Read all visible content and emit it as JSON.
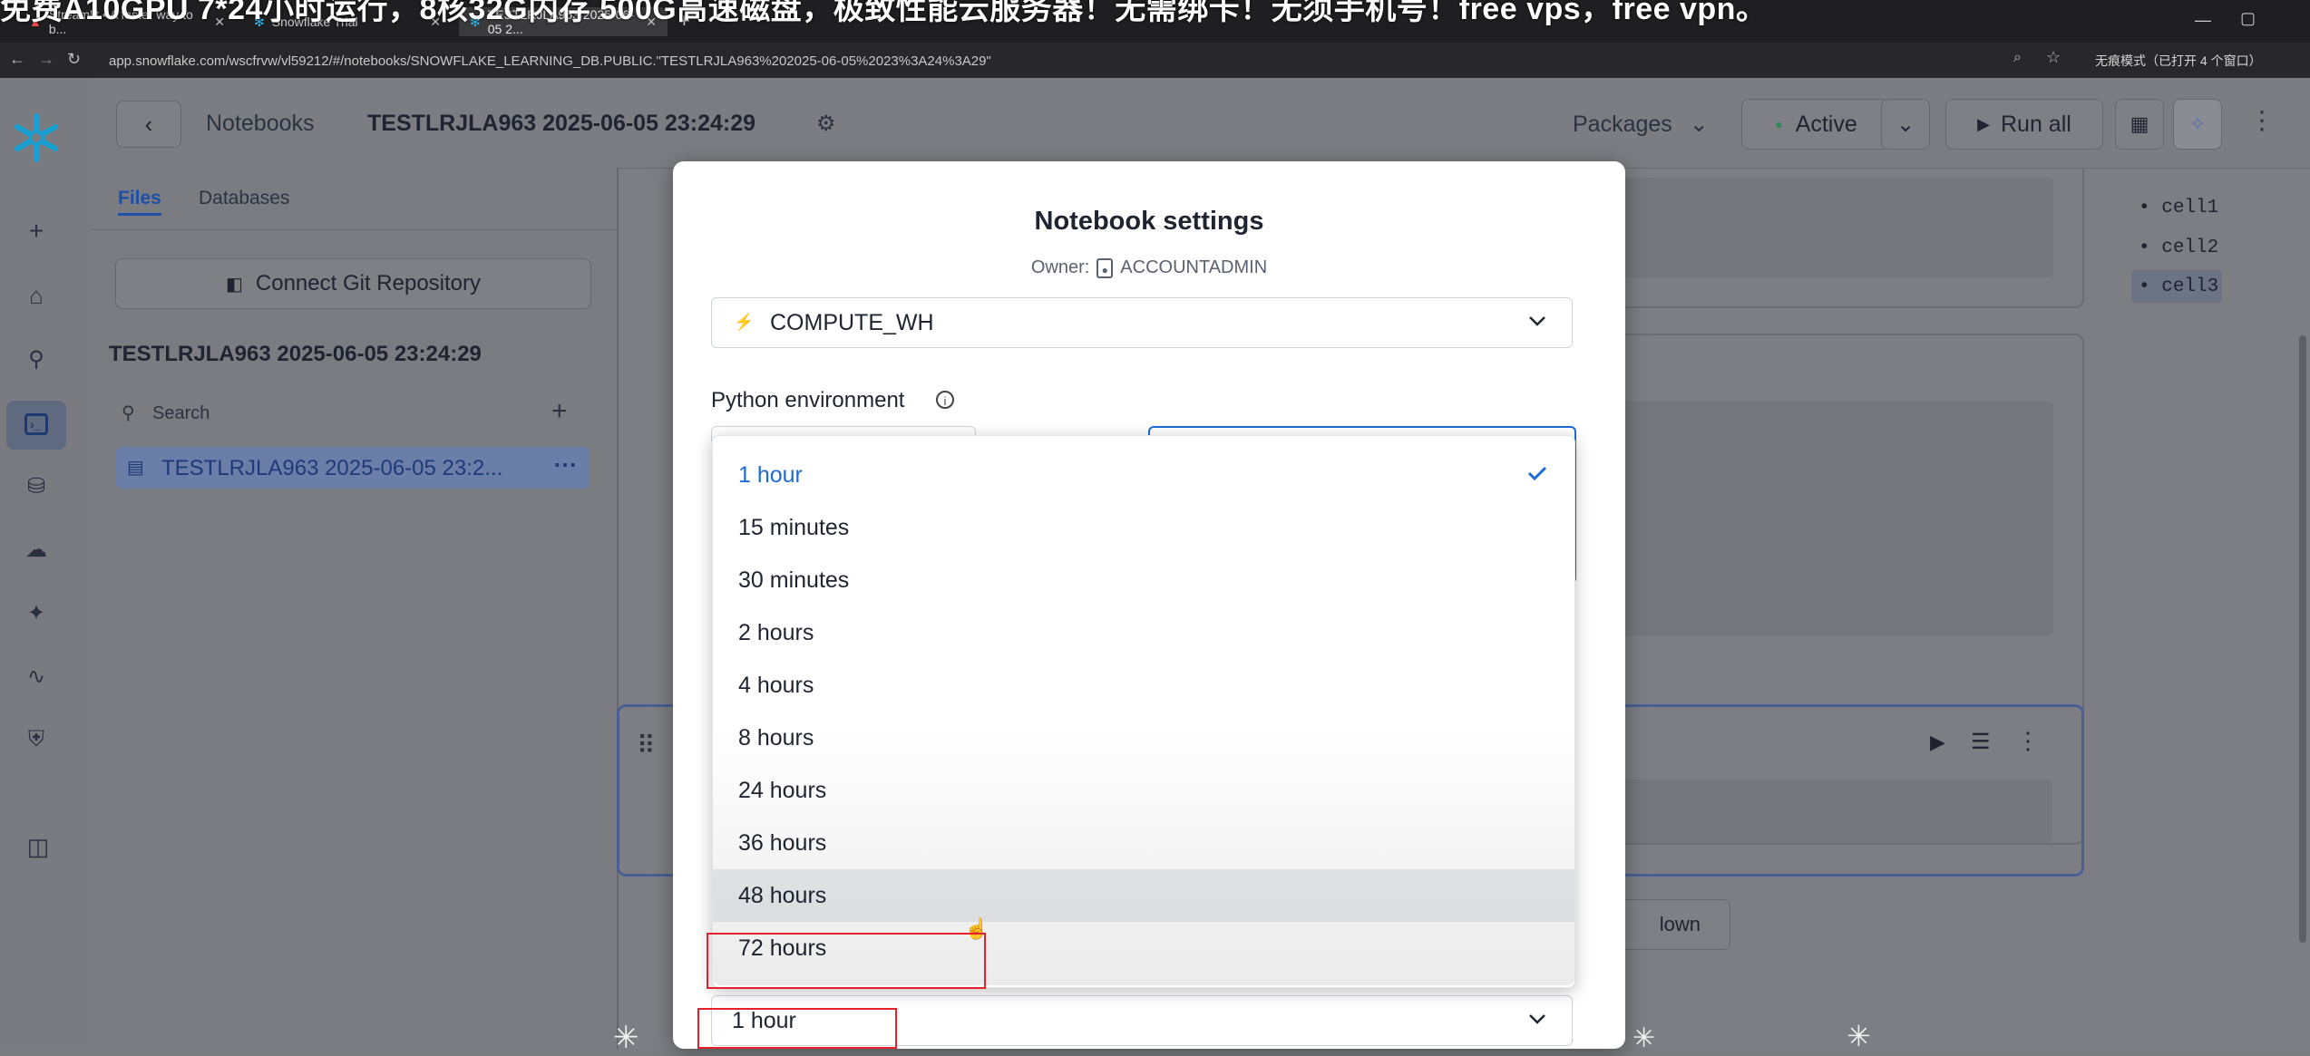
{
  "browser": {
    "banner": "免费A10GPU 7*24小时运行，8核32G内存 500G高速磁盘，极致性能云服务器！无需绑卡！无须手机号！free vps，free vpn。",
    "tabs": [
      {
        "label": "Streamlit • A faster way to b..."
      },
      {
        "label": "Snowflake Trial"
      },
      {
        "label": "TESTLRJLA963 2025-06-05 2..."
      }
    ],
    "url": "app.snowflake.com/wscfrvw/vl59212/#/notebooks/SNOWFLAKE_LEARNING_DB.PUBLIC.\"TESTLRJLA963%202025-06-05%2023%3A24%3A29\"",
    "incognito": "无痕模式（已打开 4 个窗口）"
  },
  "header": {
    "breadcrumb_root": "Notebooks",
    "notebook_title": "TESTLRJLA963 2025-06-05 23:24:29",
    "packages_label": "Packages",
    "status_label": "Active",
    "run_all_label": "Run all"
  },
  "sidebar": {
    "tabs": [
      "Files",
      "Databases"
    ],
    "connect_git_label": "Connect Git Repository",
    "section_title": "TESTLRJLA963 2025-06-05 23:24:29",
    "search_placeholder": "Search",
    "file_item": "TESTLRJLA963 2025-06-05 23:2..."
  },
  "outline": [
    "cell1",
    "cell2",
    "cell3"
  ],
  "cell_button_fragment": "lown",
  "modal": {
    "title": "Notebook settings",
    "owner_label": "Owner:",
    "owner_value": "ACCOUNTADMIN",
    "warehouse_value": "COMPUTE_WH",
    "python_env_label": "Python environment",
    "timeout_options": [
      "1 hour",
      "15 minutes",
      "30 minutes",
      "2 hours",
      "4 hours",
      "8 hours",
      "24 hours",
      "36 hours",
      "48 hours",
      "72 hours"
    ],
    "selected_option": "1 hour",
    "hovered_option": "48 hours",
    "timeout_select_value": "1 hour"
  },
  "colors": {
    "accent": "#1e6bd6",
    "annotation_red": "#e8202a",
    "snowflake_brand": "#29b5e8"
  }
}
